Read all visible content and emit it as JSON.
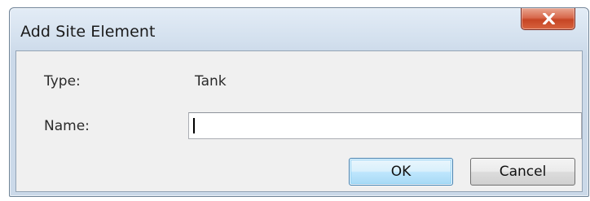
{
  "dialog": {
    "title": "Add Site Element",
    "close_glyph": "X"
  },
  "form": {
    "type_label": "Type:",
    "type_value": "Tank",
    "name_label": "Name:",
    "name_value": "",
    "name_placeholder": ""
  },
  "buttons": {
    "ok_label": "OK",
    "cancel_label": "Cancel"
  },
  "icons": {
    "close": "close-icon"
  },
  "colors": {
    "close_button": "#c64524",
    "title_bar": "#d3e0ee",
    "client_area": "#f0f0f0",
    "default_button_border": "#3c7fb1"
  }
}
